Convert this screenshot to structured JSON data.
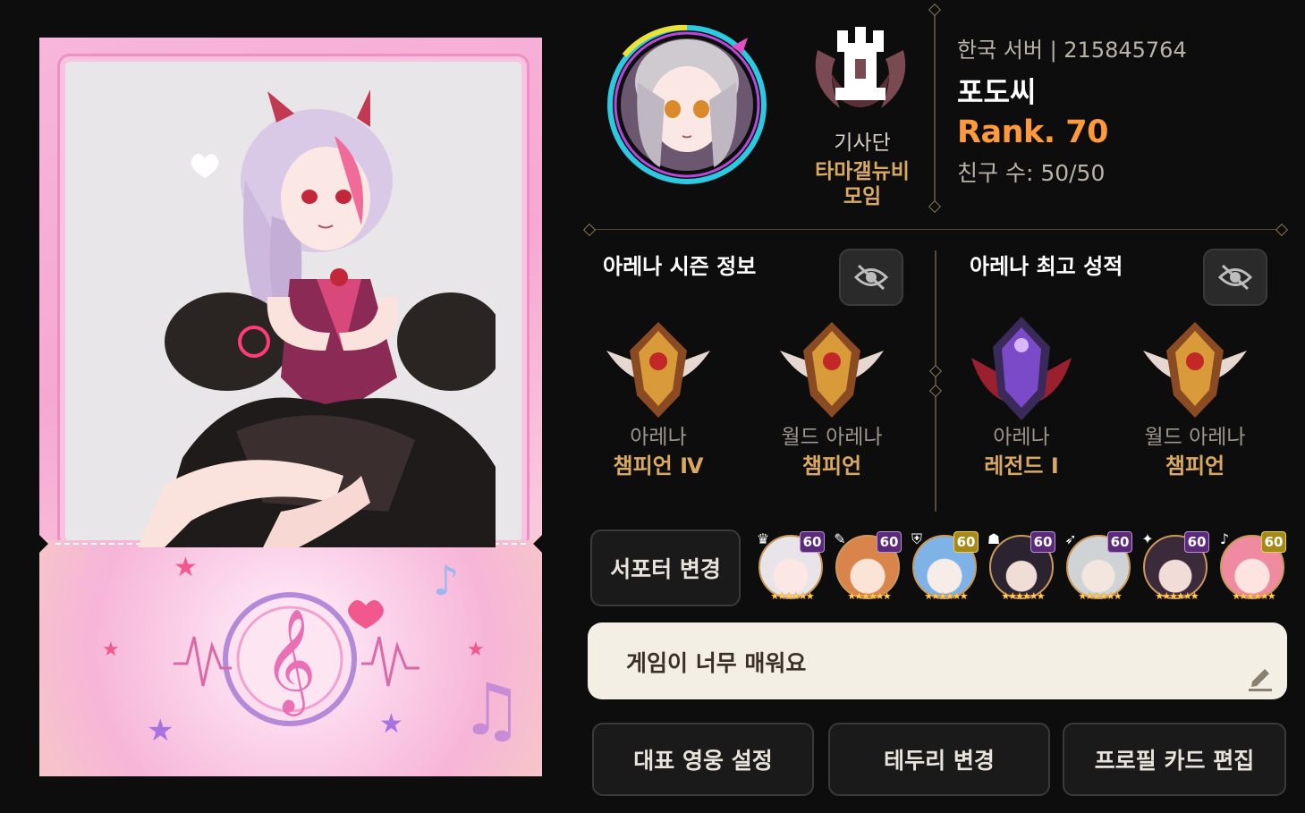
{
  "profile": {
    "server": "한국 서버 | 215845764",
    "nickname": "포도씨",
    "rank": "Rank. 70",
    "friends": "친구 수: 50/50",
    "guild": {
      "label": "기사단",
      "name_line1": "타마갤뉴비",
      "name_line2": "모임"
    }
  },
  "arena": {
    "season_title": "아레나 시즌 정보",
    "best_title": "아레나 최고 성적",
    "hide_icon": "eye-off-icon",
    "badges": [
      {
        "label": "아레나",
        "rank": "챔피언 Ⅳ",
        "tier": "champion"
      },
      {
        "label": "월드 아레나",
        "rank": "챔피언",
        "tier": "champion"
      },
      {
        "label": "아레나",
        "rank": "레전드 Ⅰ",
        "tier": "legend"
      },
      {
        "label": "월드 아레나",
        "rank": "챔피언",
        "tier": "champion"
      }
    ]
  },
  "supporters": {
    "change_label": "서포터 변경",
    "heroes": [
      {
        "level": "60",
        "class_icon": "crown-icon",
        "hair": "#e9e4ea",
        "accent": "#c23a4a",
        "lvl_bg": "#5b2a7a"
      },
      {
        "level": "60",
        "class_icon": "feather-icon",
        "hair": "#d9844a",
        "accent": "#f2c6a0",
        "lvl_bg": "#5b2a7a"
      },
      {
        "level": "60",
        "class_icon": "shield-icon",
        "hair": "#7fb2e6",
        "accent": "#d9e8f6",
        "lvl_bg": "#a58a1a"
      },
      {
        "level": "60",
        "class_icon": "hood-icon",
        "hair": "#2b2430",
        "accent": "#c9a03a",
        "lvl_bg": "#5b2a7a"
      },
      {
        "level": "60",
        "class_icon": "bow-icon",
        "hair": "#cfd3d6",
        "accent": "#8aa070",
        "lvl_bg": "#5b2a7a"
      },
      {
        "level": "60",
        "class_icon": "wizard-hat-icon",
        "hair": "#3a2a3a",
        "accent": "#b8577a",
        "lvl_bg": "#5b2a7a"
      },
      {
        "level": "60",
        "class_icon": "music-icon",
        "hair": "#f08aa0",
        "accent": "#ffd0d8",
        "lvl_bg": "#a58a1a"
      }
    ]
  },
  "comment": {
    "text": "게임이 너무 매워요",
    "edit_icon": "pencil-icon"
  },
  "buttons": {
    "rep_hero": "대표 영웅 설정",
    "border": "테두리 변경",
    "card_edit": "프로필 카드 편집"
  },
  "colors": {
    "rank": "#ff9a3a",
    "gold_text": "#d9a962",
    "background": "#0d0d0d"
  }
}
